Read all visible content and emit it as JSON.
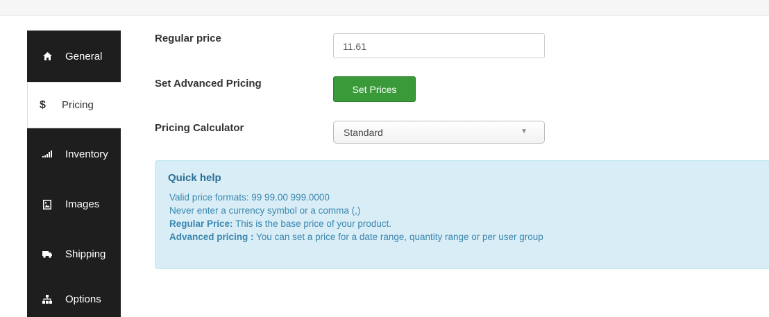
{
  "sidebar": {
    "items": [
      {
        "label": "General",
        "icon": "home-icon"
      },
      {
        "label": "Pricing",
        "icon": "dollar-icon"
      },
      {
        "label": "Inventory",
        "icon": "signal-bars-icon"
      },
      {
        "label": "Images",
        "icon": "image-icon"
      },
      {
        "label": "Shipping",
        "icon": "truck-icon"
      },
      {
        "label": "Options",
        "icon": "sitemap-icon"
      }
    ],
    "active": "Pricing",
    "dollar_symbol": "$"
  },
  "form": {
    "regular_price_label": "Regular price",
    "regular_price_value": "11.61",
    "advanced_pricing_label": "Set Advanced Pricing",
    "set_prices_button": "Set Prices",
    "calculator_label": "Pricing Calculator",
    "calculator_value": "Standard",
    "select_caret": "▼"
  },
  "help": {
    "title": "Quick help",
    "line1": "Valid price formats: 99 99.00 999.0000",
    "line2": "Never enter a currency symbol or a comma (,)",
    "line3_bold": "Regular Price:",
    "line3_text": " This is the base price of your product.",
    "line4_bold": "Advanced pricing :",
    "line4_text": " You can set a price for a date range, quantity range or per user group"
  },
  "colors": {
    "sidebar_bg": "#1e1e1e",
    "button_green": "#3a9a3a",
    "help_bg": "#d9edf7",
    "help_text": "#3a87ad"
  }
}
